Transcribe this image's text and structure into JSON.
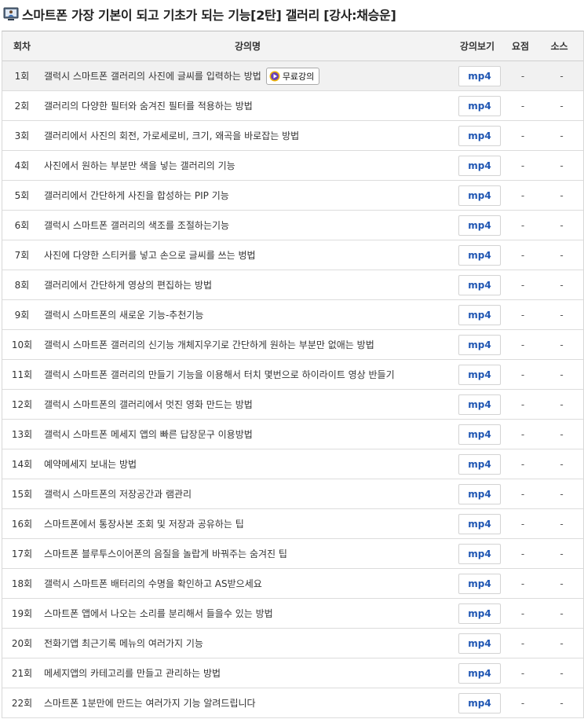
{
  "page": {
    "title": "스마트폰 가장 기본이 되고 기초가 되는 기능[2탄] 갤러리 [강사:채승운]"
  },
  "table": {
    "headers": {
      "no": "회차",
      "title": "강의명",
      "view": "강의보기",
      "summary": "요점",
      "source": "소스"
    },
    "free_label": "무료강의",
    "view_label": "mp4",
    "dash": "-",
    "rows": [
      {
        "no": "1회",
        "title": "갤럭시 스마트폰 갤러리의 사진에 글씨를 입력하는 방법"
      },
      {
        "no": "2회",
        "title": "갤러리의 다양한 필터와 숨겨진 필터를 적용하는 방법"
      },
      {
        "no": "3회",
        "title": "갤러리에서 사진의 회전, 가로세로비, 크기, 왜곡을 바로잡는 방법"
      },
      {
        "no": "4회",
        "title": "사진에서 원하는 부분만 색을 넣는 갤러리의 기능"
      },
      {
        "no": "5회",
        "title": "갤러리에서 간단하게 사진을 합성하는 PIP 기능"
      },
      {
        "no": "6회",
        "title": "갤럭시 스마트폰 갤러리의 색조를 조절하는기능"
      },
      {
        "no": "7회",
        "title": "사진에 다양한 스티커를 넣고 손으로 글씨를 쓰는 벙법"
      },
      {
        "no": "8회",
        "title": "갤러리에서 간단하게 영상의 편집하는 방법"
      },
      {
        "no": "9회",
        "title": "갤럭시 스마트폰의 새로운 기능-추천기능"
      },
      {
        "no": "10회",
        "title": "갤럭시 스마트폰 갤러리의 신기능 개체지우기로 간단하게 원하는 부분만 없애는 방법"
      },
      {
        "no": "11회",
        "title": "갤럭시 스마트폰 갤러리의 만들기 기능을 이용해서 터치 몇번으로 하이라이트 영상 반들기"
      },
      {
        "no": "12회",
        "title": "갤럭시 스마트폰의 갤러리에서 멋진 영화 만드는 방법"
      },
      {
        "no": "13회",
        "title": "갤럭시 스마트폰 메세지 앱의 빠른 답장문구 이용방법"
      },
      {
        "no": "14회",
        "title": "예약메세지 보내는 방법"
      },
      {
        "no": "15회",
        "title": "갤럭시 스마트폰의 저장공간과 램관리"
      },
      {
        "no": "16회",
        "title": "스마트폰에서 통장사본 조회 및 저장과 공유하는 팁"
      },
      {
        "no": "17회",
        "title": "스마트폰 블루투스이어폰의 음질을 놀랍게 바꿔주는 숨겨진 팁"
      },
      {
        "no": "18회",
        "title": "갤럭시 스마트폰 배터리의 수명을 확인하고 AS받으세요"
      },
      {
        "no": "19회",
        "title": "스마트폰 앱에서 나오는 소리를 분리해서 들을수 있는 방법"
      },
      {
        "no": "20회",
        "title": "전화기앱 최근기록 메뉴의 여러가지 기능"
      },
      {
        "no": "21회",
        "title": "메세지앱의 카테고리를 만들고 관리하는 방법"
      },
      {
        "no": "22회",
        "title": "스마트폰 1분만에 만드는 여러가지 기능 알려드립니다"
      }
    ]
  }
}
